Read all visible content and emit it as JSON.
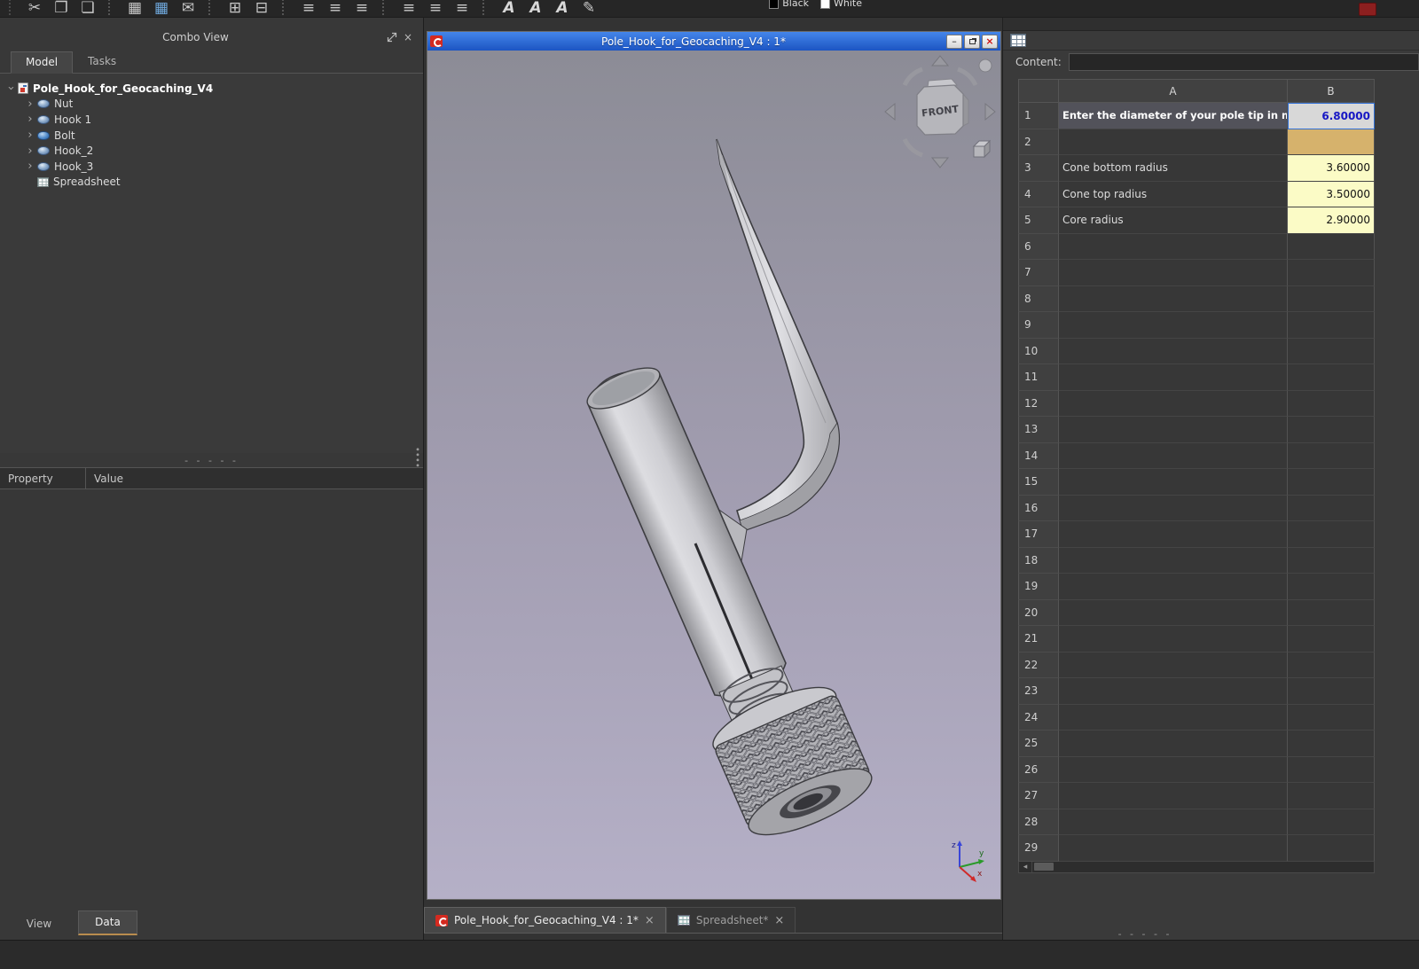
{
  "window": {
    "title": "Pole_Hook_for_Geocaching_V4 : 1*"
  },
  "toolbar": {
    "groups": [
      {
        "icons": [
          {
            "name": "cut",
            "glyph": "✂"
          },
          {
            "name": "copy",
            "glyph": "❐"
          },
          {
            "name": "paste",
            "glyph": "❏"
          }
        ]
      },
      {
        "icons": [
          {
            "name": "show-spreadsheet",
            "glyph": "▦"
          },
          {
            "name": "create-spreadsheet",
            "glyph": "▦",
            "color": "#6fa8dc"
          },
          {
            "name": "export-spreadsheet",
            "glyph": "✉"
          }
        ]
      },
      {
        "icons": [
          {
            "name": "merge-cells",
            "glyph": "⊞"
          },
          {
            "name": "split-cell",
            "glyph": "⊟"
          }
        ]
      },
      {
        "icons": [
          {
            "name": "align-left",
            "glyph": "≡"
          },
          {
            "name": "align-center",
            "glyph": "≡"
          },
          {
            "name": "align-right",
            "glyph": "≡"
          }
        ]
      },
      {
        "icons": [
          {
            "name": "align-top",
            "glyph": "≡"
          },
          {
            "name": "align-vcenter",
            "glyph": "≡"
          },
          {
            "name": "align-bottom",
            "glyph": "≡"
          }
        ]
      },
      {
        "icons": [
          {
            "name": "style-bold",
            "glyph": "A",
            "cls": "italicA"
          },
          {
            "name": "style-italic",
            "glyph": "A",
            "cls": "italicA"
          },
          {
            "name": "font-size",
            "glyph": "A",
            "cls": "italicA"
          },
          {
            "name": "set-alias",
            "glyph": "✎"
          }
        ]
      }
    ],
    "black_label": "Black",
    "white_label": "White"
  },
  "combo_view": {
    "title": "Combo View",
    "tabs": {
      "model": "Model",
      "tasks": "Tasks"
    },
    "tree": {
      "root": "Pole_Hook_for_Geocaching_V4",
      "items": [
        {
          "label": "Nut",
          "icon": "part",
          "expandable": true
        },
        {
          "label": "Hook 1",
          "icon": "part",
          "expandable": true
        },
        {
          "label": "Bolt",
          "icon": "part-blue",
          "expandable": true
        },
        {
          "label": "Hook_2",
          "icon": "part",
          "expandable": true
        },
        {
          "label": "Hook_3",
          "icon": "part",
          "expandable": true
        },
        {
          "label": "Spreadsheet",
          "icon": "sheet-ic",
          "expandable": false
        }
      ]
    },
    "property_header": "Property",
    "value_header": "Value",
    "bottom_tabs": {
      "view": "View",
      "data": "Data"
    }
  },
  "viewport": {
    "nav_cube_label": "FRONT",
    "axes": {
      "x": "x",
      "y": "y",
      "z": "z"
    }
  },
  "spreadsheet": {
    "content_label": "Content:",
    "content_value": "",
    "columns": [
      "A",
      "B"
    ],
    "row_count": 29,
    "cells": {
      "1": {
        "a": "Enter the diameter of your pole tip in mm",
        "b": "6.80000",
        "a_class": "sel-label",
        "b_class": "sel-value"
      },
      "2": {
        "a": "",
        "b": "",
        "b_class": "tan"
      },
      "3": {
        "a": "Cone bottom radius",
        "b": "3.60000",
        "b_class": "yellow"
      },
      "4": {
        "a": "Cone top radius",
        "b": "3.50000",
        "b_class": "yellow"
      },
      "5": {
        "a": "Core radius",
        "b": "2.90000",
        "b_class": "yellow"
      }
    }
  },
  "mdi_tabs": [
    {
      "label": "Pole_Hook_for_Geocaching_V4 : 1*"
    },
    {
      "label": "Spreadsheet*"
    }
  ],
  "colors": {
    "titlebar_top": "#4586ea",
    "titlebar_bottom": "#1c54c2",
    "selected_cell_bg": "#d8d8d8",
    "selected_cell_text": "#1717c4",
    "tan_cell": "#d6b26c",
    "yellow_cell": "#fbfbc6"
  }
}
